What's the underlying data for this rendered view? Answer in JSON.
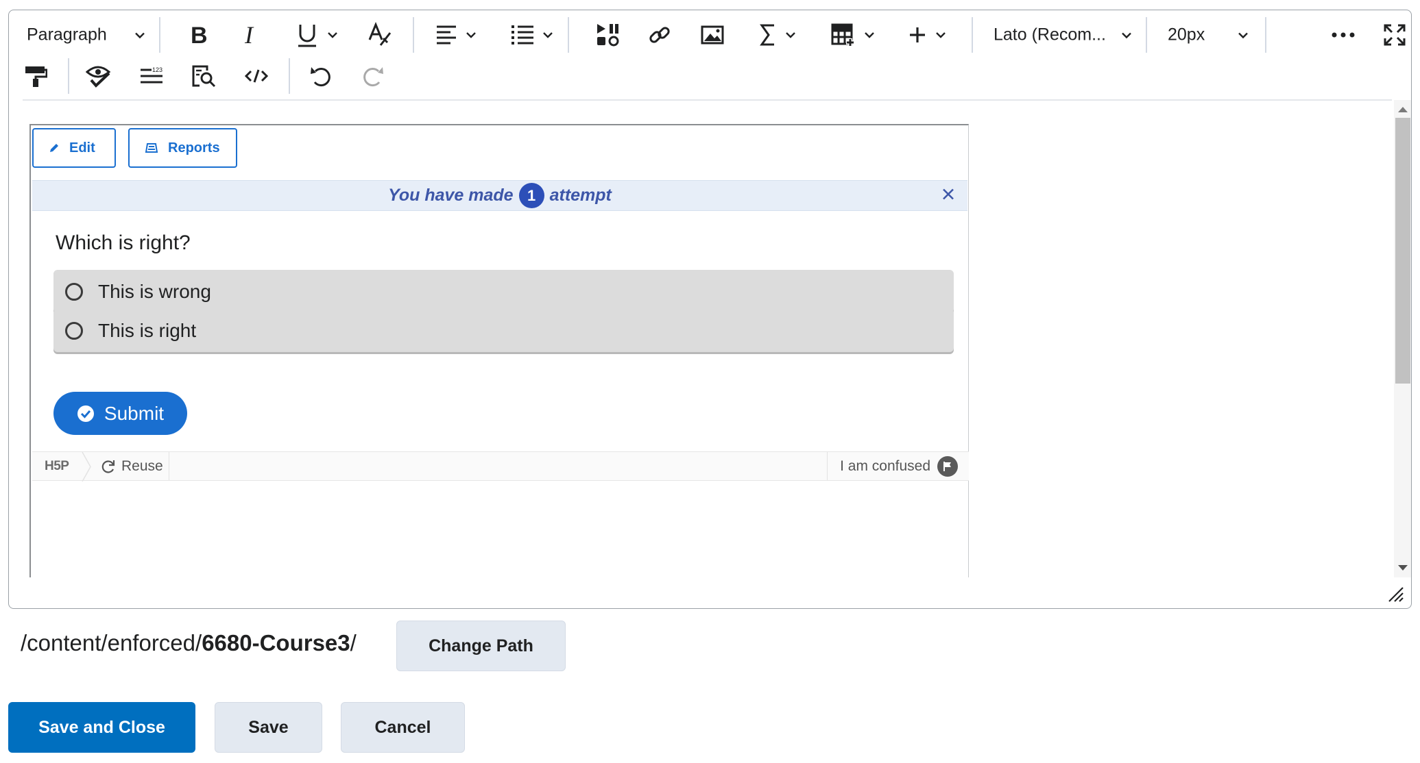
{
  "toolbar": {
    "paragraph_label": "Paragraph",
    "font_family": "Lato (Recom...",
    "font_size": "20px"
  },
  "h5p": {
    "edit_label": "Edit",
    "reports_label": "Reports",
    "attempt_prefix": "You have made",
    "attempt_count": "1",
    "attempt_suffix": "attempt",
    "question": "Which is right?",
    "answers": [
      {
        "label": "This is wrong"
      },
      {
        "label": "This is right"
      }
    ],
    "submit_label": "Submit",
    "footer": {
      "logo": "H5P",
      "reuse_label": "Reuse",
      "confused_label": "I am confused"
    }
  },
  "path": {
    "prefix": "/content/enforced/",
    "course": "6680-Course3",
    "suffix": "/",
    "change_label": "Change Path"
  },
  "actions": {
    "save_close": "Save and Close",
    "save": "Save",
    "cancel": "Cancel"
  },
  "colors": {
    "primary": "#006fbf",
    "h5p_blue": "#1a6fd0",
    "attempt_badge": "#2c4fb8"
  }
}
